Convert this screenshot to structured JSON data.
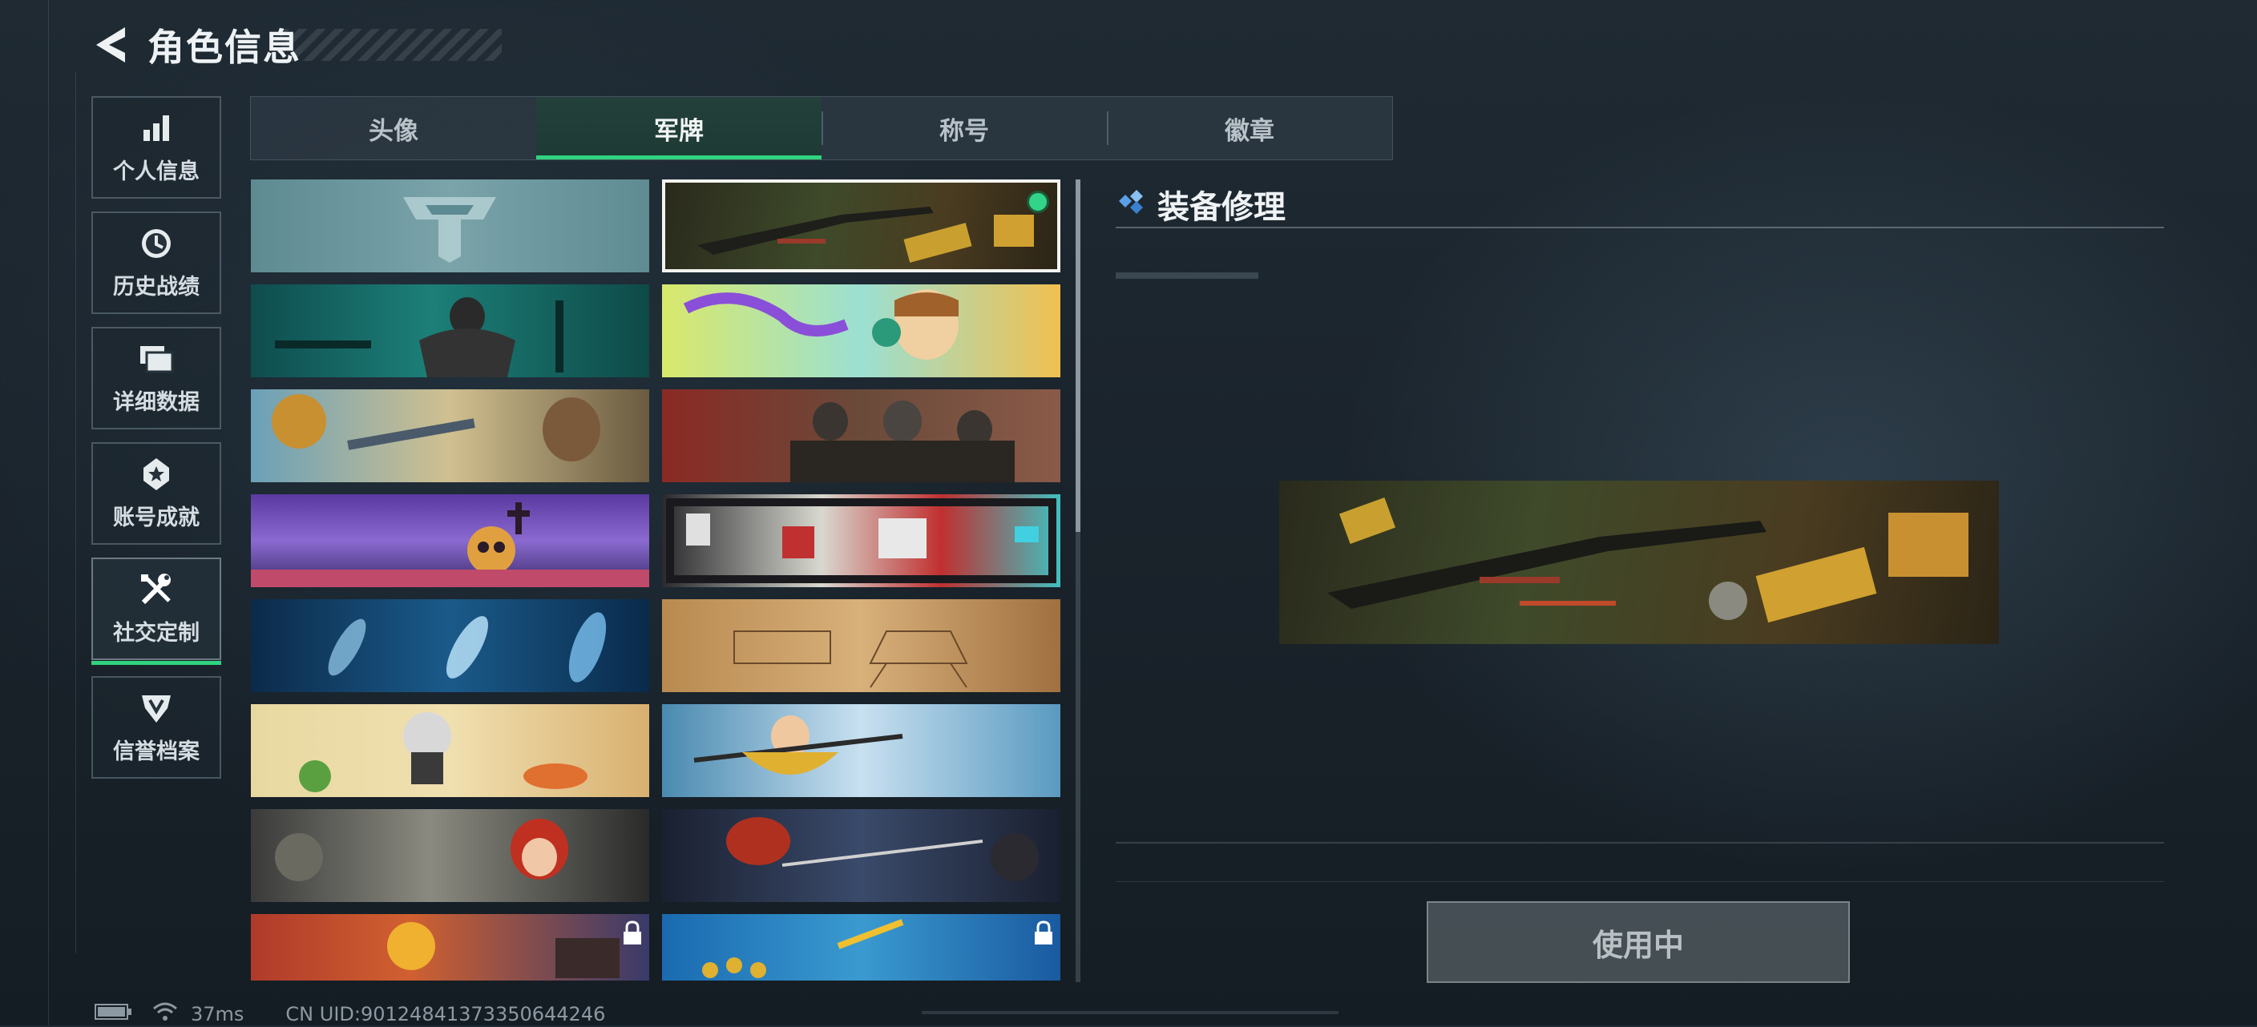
{
  "header": {
    "title": "角色信息"
  },
  "nav": {
    "items": [
      {
        "label": "个人信息",
        "icon": "bar-chart-icon",
        "active": false
      },
      {
        "label": "历史战绩",
        "icon": "history-clock-icon",
        "active": false
      },
      {
        "label": "详细数据",
        "icon": "folder-icon",
        "active": false
      },
      {
        "label": "账号成就",
        "icon": "achievement-medal-icon",
        "active": false
      },
      {
        "label": "社交定制",
        "icon": "wrench-screwdriver-icon",
        "active": true
      },
      {
        "label": "信誉档案",
        "icon": "shield-emblem-icon",
        "active": false
      }
    ]
  },
  "tabs": [
    {
      "label": "头像",
      "active": false
    },
    {
      "label": "军牌",
      "active": true
    },
    {
      "label": "称号",
      "active": false
    },
    {
      "label": "徽章",
      "active": false
    }
  ],
  "banners": [
    {
      "id": "default-logo",
      "selected": false,
      "locked": false
    },
    {
      "id": "equipment-repair",
      "selected": true,
      "locked": false
    },
    {
      "id": "gym-teal",
      "selected": false,
      "locked": false
    },
    {
      "id": "music-headphones",
      "selected": false,
      "locked": false
    },
    {
      "id": "workshop-girl",
      "selected": false,
      "locked": false
    },
    {
      "id": "soldiers-red",
      "selected": false,
      "locked": false
    },
    {
      "id": "graveyard-skull",
      "selected": false,
      "locked": false
    },
    {
      "id": "pixel-arcade",
      "selected": false,
      "locked": false
    },
    {
      "id": "xray-skeletons",
      "selected": false,
      "locked": false
    },
    {
      "id": "blueprint-mech",
      "selected": false,
      "locked": false
    },
    {
      "id": "kitchen-chibi",
      "selected": false,
      "locked": false
    },
    {
      "id": "archer-girl",
      "selected": false,
      "locked": false
    },
    {
      "id": "chibi-redhead",
      "selected": false,
      "locked": false
    },
    {
      "id": "dark-warrior",
      "selected": false,
      "locked": false
    },
    {
      "id": "explosion-red",
      "selected": false,
      "locked": true
    },
    {
      "id": "blue-figures",
      "selected": false,
      "locked": true
    }
  ],
  "preview": {
    "title": "装备修理",
    "button_label": "使用中"
  },
  "status": {
    "ping": "37ms",
    "uid": "CN UID:90124841373350644246"
  },
  "colors": {
    "accent_green": "#2fd37f",
    "background": "#1f2a33",
    "selected_border": "#f3f3f0"
  }
}
